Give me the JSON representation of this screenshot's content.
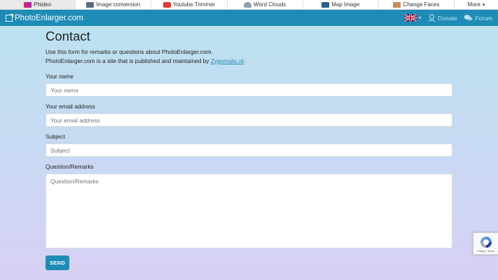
{
  "topbar": {
    "items": [
      {
        "label": "Phideo",
        "icon": "phideo-icon",
        "color": "#c2185b"
      },
      {
        "label": "Image conversion",
        "icon": "image-conversion-icon",
        "color": "#5a6a7a"
      },
      {
        "label": "Youtube Trimmer",
        "icon": "youtube-icon",
        "color": "#e53935"
      },
      {
        "label": "Word Clouds",
        "icon": "cloud-icon",
        "color": "#8aa0b0"
      },
      {
        "label": "Map Image",
        "icon": "map-icon",
        "color": "#2c5f8a"
      },
      {
        "label": "Change Faces",
        "icon": "face-icon",
        "color": "#c98c5a"
      }
    ],
    "more_label": "More",
    "more_caret": "▾"
  },
  "navbar": {
    "brand": "PhotoEnlarger.com",
    "caret": "▾",
    "donate": "Donate",
    "forum": "Forum"
  },
  "page": {
    "title": "Contact",
    "intro_line1": "Use this form for remarks or questions about PhotoEnlarger.com.",
    "intro_line2_prefix": "PhotoEnlarger.com is a site that is published and maintained by ",
    "intro_link": "Zygomatic.nl",
    "intro_line2_suffix": "."
  },
  "form": {
    "name_label": "Your name",
    "name_placeholder": "Your name",
    "email_label": "Your email address",
    "email_placeholder": "Your email address",
    "subject_label": "Subject",
    "subject_placeholder": "Subject",
    "remarks_label": "Question/Remarks",
    "remarks_placeholder": "Question/Remarks",
    "send_label": "SEND"
  },
  "recaptcha": {
    "links": "Privacy - Terms"
  },
  "colors": {
    "accent": "#1e8cb6",
    "link": "#1e8cb6"
  }
}
